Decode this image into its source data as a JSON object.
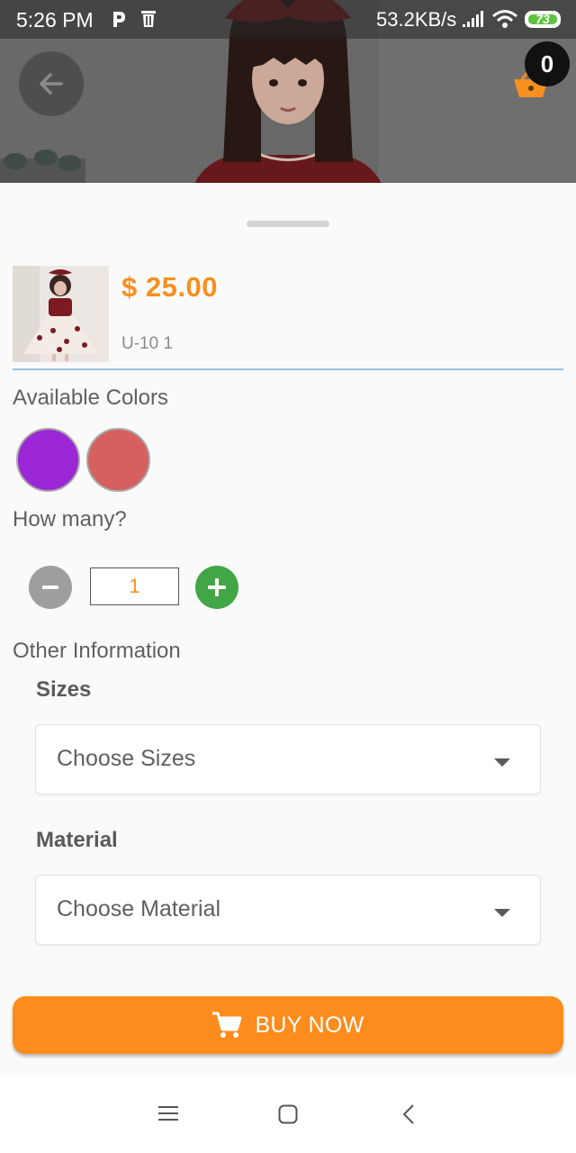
{
  "status_bar": {
    "time": "5:26 PM",
    "network_speed": "53.2KB/s",
    "battery_level": "73",
    "icons": [
      "parking-app-icon",
      "delete-icon",
      "signal-icon",
      "wifi-icon",
      "battery-icon"
    ]
  },
  "header": {
    "back_icon": "arrow-left-icon",
    "cart_icon": "basket-icon",
    "cart_count": "0"
  },
  "product": {
    "price": "$ 25.00",
    "sku": "U-10 1"
  },
  "colors": {
    "label": "Available Colors",
    "options": [
      {
        "name": "purple",
        "hex": "#9b27d6"
      },
      {
        "name": "coral",
        "hex": "#d66060"
      }
    ]
  },
  "quantity": {
    "label": "How many?",
    "value": "1",
    "decrement_color": "#9e9e9e",
    "increment_color": "#43a646"
  },
  "other_info": {
    "label": "Other Information",
    "sizes": {
      "label": "Sizes",
      "selected": "Choose Sizes"
    },
    "material": {
      "label": "Material",
      "selected": "Choose Material"
    }
  },
  "buy_button": {
    "label": "BUY NOW",
    "icon": "cart-icon",
    "color": "#fd8c1c"
  },
  "accent_color": "#f7901e",
  "nav_bar": {
    "icons": [
      "menu-icon",
      "home-icon",
      "back-chevron-icon"
    ]
  }
}
